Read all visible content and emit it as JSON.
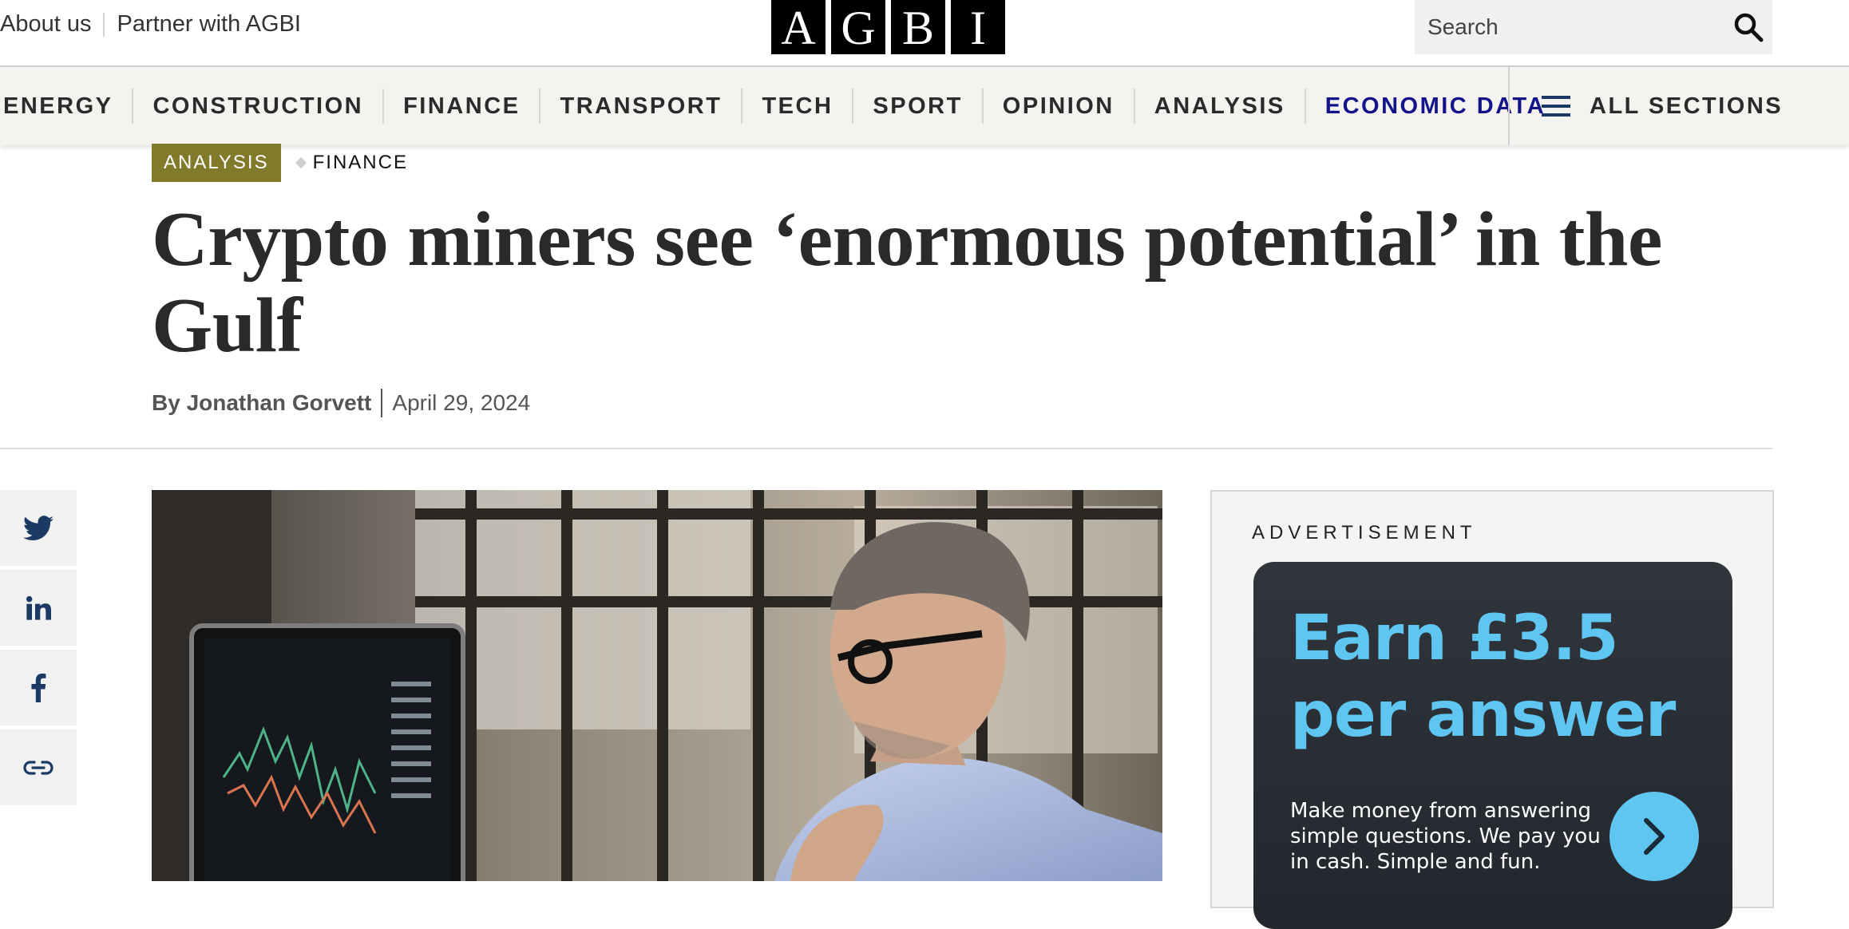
{
  "top_links": [
    "About us",
    "Partner with AGBI"
  ],
  "logo_letters": [
    "A",
    "G",
    "B",
    "I"
  ],
  "search": {
    "placeholder": "Search"
  },
  "nav": {
    "items": [
      "ENERGY",
      "CONSTRUCTION",
      "FINANCE",
      "TRANSPORT",
      "TECH",
      "SPORT",
      "OPINION",
      "ANALYSIS",
      "ECONOMIC DATA"
    ],
    "highlight_color": "#14148a",
    "all_sections": "ALL SECTIONS"
  },
  "article": {
    "tag_primary": "ANALYSIS",
    "tag_secondary": "FINANCE",
    "headline": "Crypto miners see ‘enormous potential’ in the Gulf",
    "byline_prefix": "By",
    "author": "Jonathan Gorvett",
    "date": "April 29, 2024"
  },
  "share_icons": [
    "twitter-icon",
    "linkedin-icon",
    "facebook-icon",
    "link-icon"
  ],
  "ad": {
    "label": "ADVERTISEMENT",
    "headline": "Earn £3.5 per answer",
    "body": "Make money from answering simple questions. We pay you in cash. Simple and fun.",
    "accent_color": "#5ec6f0"
  },
  "colors": {
    "tag_background": "#827a2b",
    "nav_background": "#f4f3ef",
    "share_icon": "#1a3a63"
  }
}
